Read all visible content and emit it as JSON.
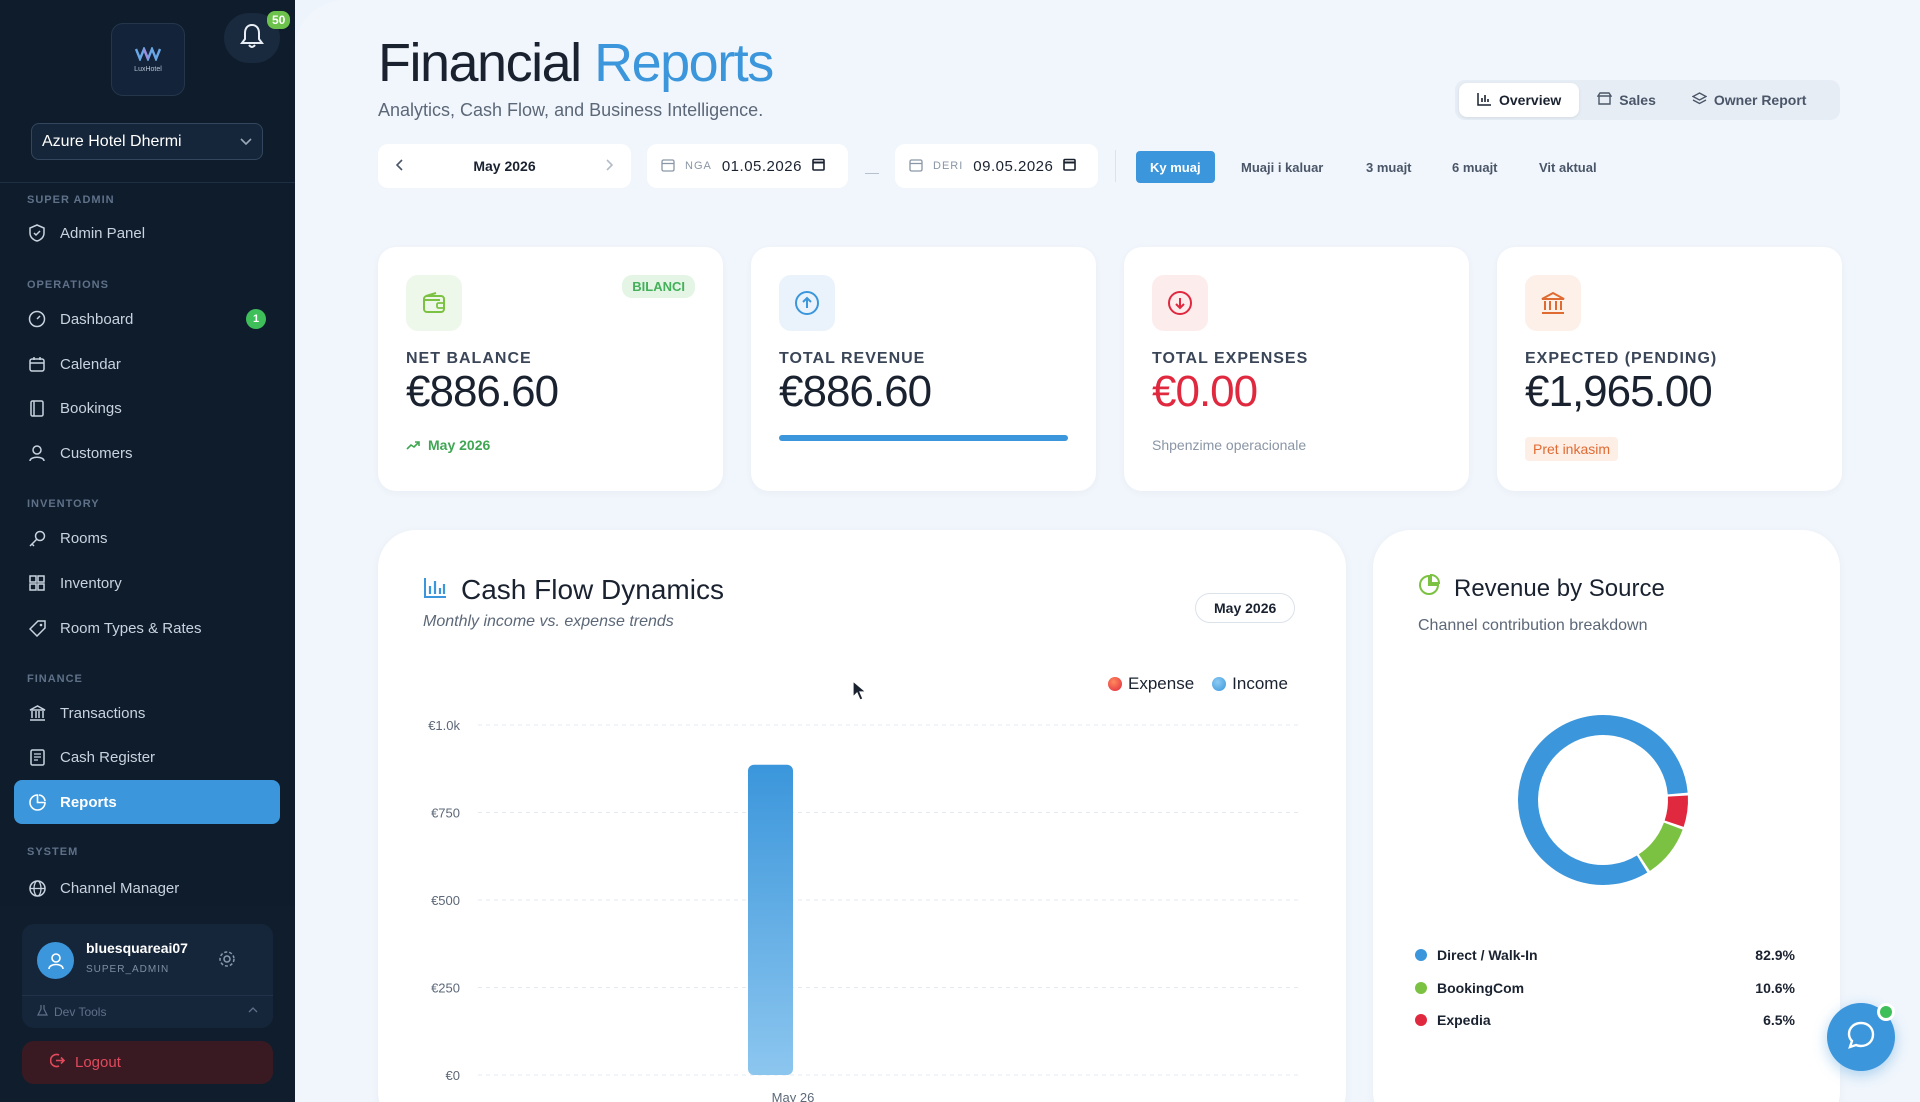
{
  "sidebar": {
    "logo_text": "LuxHotel",
    "notifications_count": "50",
    "hotel": "Azure Hotel Dhermi",
    "sections": {
      "super_admin": "SUPER ADMIN",
      "operations": "OPERATIONS",
      "inventory": "INVENTORY",
      "finance": "FINANCE",
      "system": "SYSTEM"
    },
    "items": {
      "admin_panel": "Admin Panel",
      "dashboard": "Dashboard",
      "dashboard_badge": "1",
      "calendar": "Calendar",
      "bookings": "Bookings",
      "customers": "Customers",
      "rooms": "Rooms",
      "inventory": "Inventory",
      "room_types": "Room Types & Rates",
      "transactions": "Transactions",
      "cash_register": "Cash Register",
      "reports": "Reports",
      "channel_manager": "Channel Manager"
    },
    "user": {
      "name": "bluesquareai07",
      "role": "SUPER_ADMIN"
    },
    "dev_tools": "Dev Tools",
    "logout": "Logout"
  },
  "header": {
    "title_main": "Financial",
    "title_accent": "Reports",
    "subtitle": "Analytics, Cash Flow, and Business Intelligence.",
    "tabs": [
      "Overview",
      "Sales",
      "Owner Report"
    ],
    "active_tab": "Overview"
  },
  "filters": {
    "month": "May 2026",
    "from_prefix": "NGA",
    "from_date": "01.05.2026",
    "to_prefix": "DERI",
    "to_date": "09.05.2026",
    "dash": "—",
    "ranges": [
      "Ky muaj",
      "Muaji i kaluar",
      "3 muajt",
      "6 muajt",
      "Vit aktual"
    ],
    "active_range": "Ky muaj"
  },
  "kpis": {
    "net_balance": {
      "label": "NET BALANCE",
      "value": "€886.60",
      "tag": "BILANCI",
      "foot": "May 2026"
    },
    "total_revenue": {
      "label": "TOTAL REVENUE",
      "value": "€886.60",
      "progress": 1.0
    },
    "total_expenses": {
      "label": "TOTAL EXPENSES",
      "value": "€0.00",
      "foot": "Shpenzime operacionale"
    },
    "expected": {
      "label": "EXPECTED (PENDING)",
      "value": "€1,965.00",
      "pill": "Pret inkasim"
    }
  },
  "cash_flow": {
    "title": "Cash Flow Dynamics",
    "subtitle": "Monthly income vs. expense trends",
    "chip": "May 2026",
    "legend": {
      "expense": "Expense",
      "income": "Income"
    }
  },
  "revenue_source": {
    "title": "Revenue by Source",
    "subtitle": "Channel contribution breakdown",
    "sources": [
      {
        "name": "Direct / Walk-In",
        "pct": "82.9%",
        "color": "#3b96db"
      },
      {
        "name": "BookingCom",
        "pct": "10.6%",
        "color": "#7cc242"
      },
      {
        "name": "Expedia",
        "pct": "6.5%",
        "color": "#e0283f"
      }
    ]
  },
  "colors": {
    "accent": "#3b96db",
    "income": "#3b96db",
    "expense": "#f05a3a",
    "green": "#3fbf5a",
    "red": "#e0283f"
  },
  "chart_data": {
    "type": "bar",
    "categories": [
      "May 26"
    ],
    "series": [
      {
        "name": "Income",
        "values": [
          886.6
        ]
      },
      {
        "name": "Expense",
        "values": [
          0
        ]
      }
    ],
    "yticks": [
      "€0",
      "€250",
      "€500",
      "€750",
      "€1.0k"
    ],
    "ylim": [
      0,
      1000
    ],
    "xlabel": "",
    "ylabel": "",
    "legend": "top-right",
    "grid": true
  },
  "donut_data": {
    "type": "pie",
    "categories": [
      "Direct / Walk-In",
      "BookingCom",
      "Expedia"
    ],
    "values": [
      82.9,
      10.6,
      6.5
    ]
  }
}
